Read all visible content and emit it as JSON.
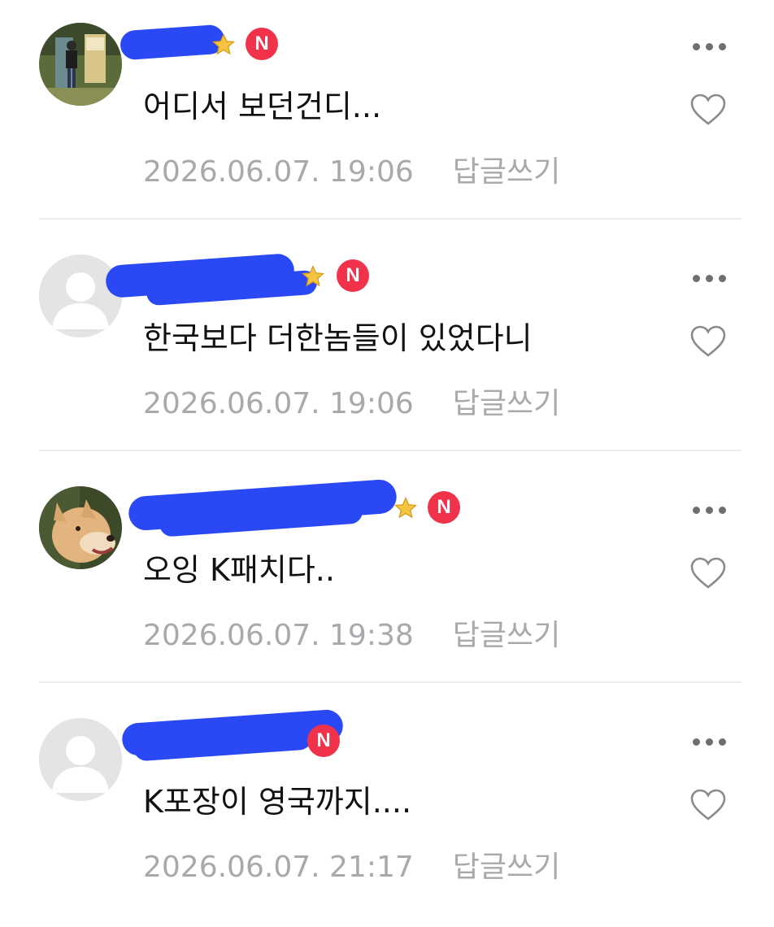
{
  "comments": [
    {
      "nickname": "",
      "has_badge_star": true,
      "badge": "N",
      "text": "어디서 보던건디...",
      "date": "2026.06.07. 19:06",
      "reply_label": "답글쓰기",
      "avatar": "photo-person"
    },
    {
      "nickname": "",
      "has_badge_star": true,
      "badge": "N",
      "text": "한국보다 더한놈들이 있었다니",
      "date": "2026.06.07. 19:06",
      "reply_label": "답글쓰기",
      "avatar": "default-profile"
    },
    {
      "nickname": "",
      "has_badge_star": true,
      "badge": "N",
      "text": "오잉 K패치다..",
      "date": "2026.06.07. 19:38",
      "reply_label": "답글쓰기",
      "avatar": "photo-dog"
    },
    {
      "nickname": "",
      "has_badge_star": false,
      "badge": "N",
      "text": "K포장이 영국까지....",
      "date": "2026.06.07. 21:17",
      "reply_label": "답글쓰기",
      "avatar": "default-profile"
    }
  ],
  "colors": {
    "badge": "#f0334b",
    "meta_text": "#a9a9ad",
    "redaction": "#2a49f5",
    "star": "#f5c542"
  },
  "icons": [
    "more-options-icon",
    "heart-icon",
    "star-icon",
    "default-profile-icon"
  ]
}
